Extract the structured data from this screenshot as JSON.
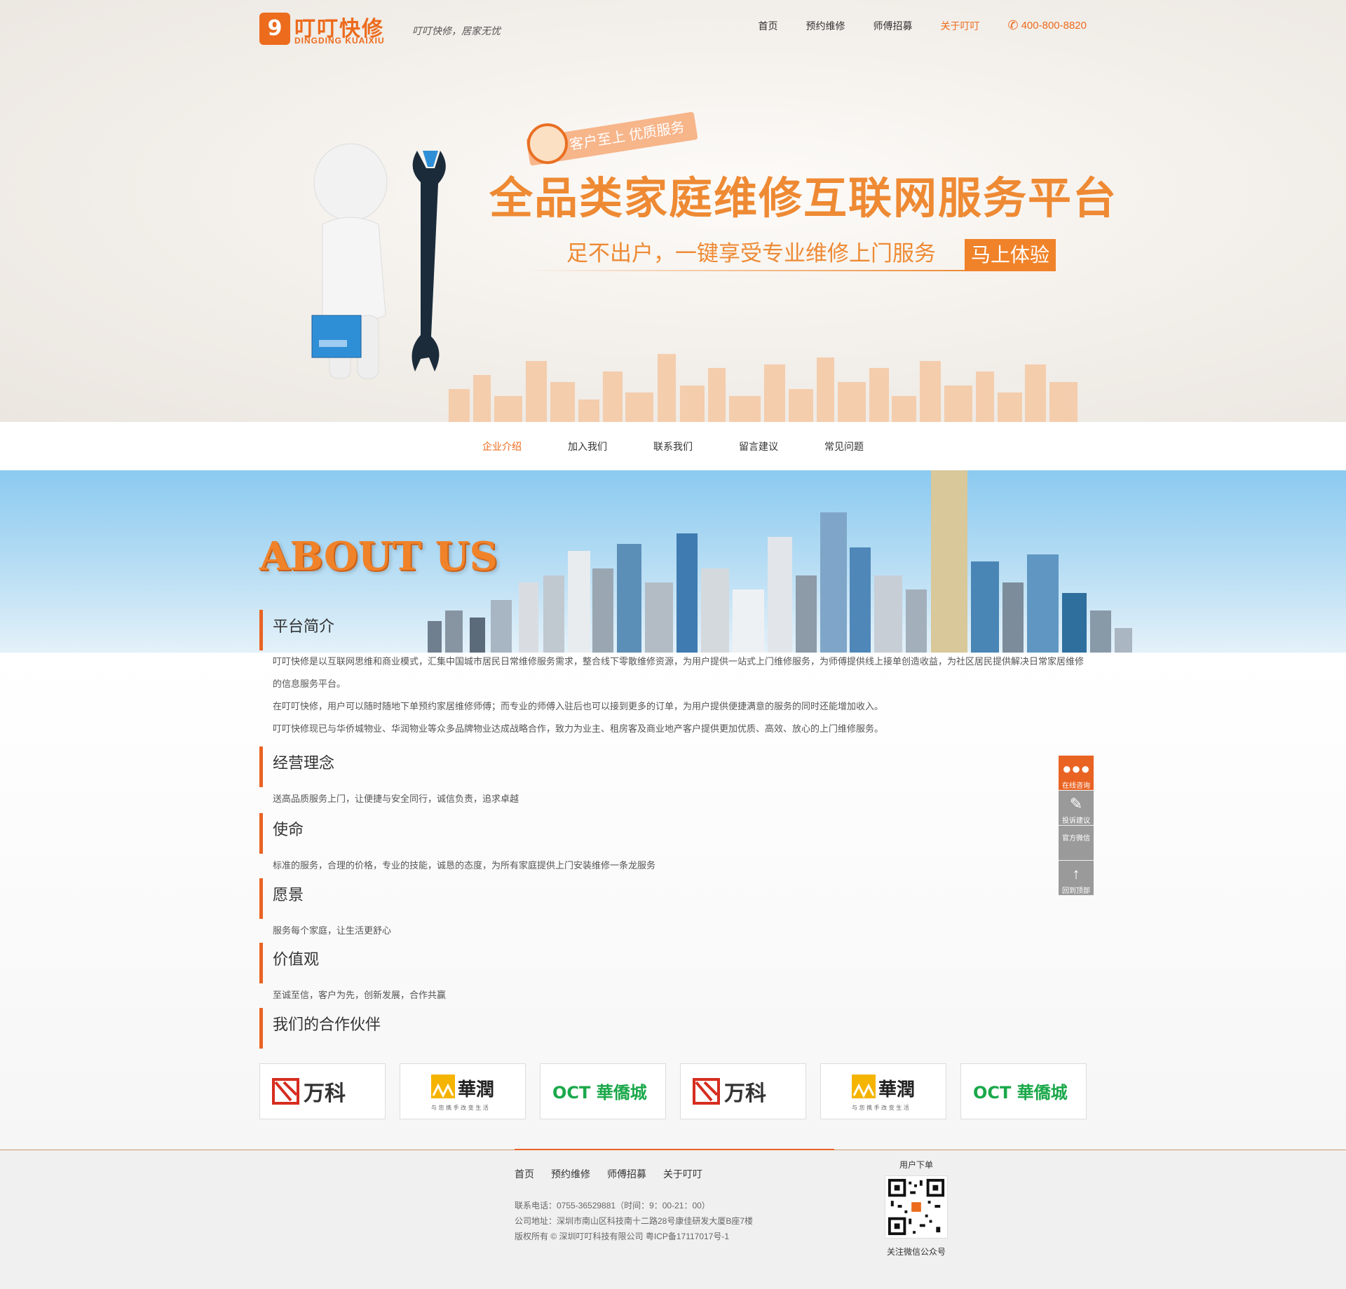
{
  "brand": {
    "mark": "9",
    "name_cn": "叮叮快修",
    "name_en": "DINGDING KUAIXIU",
    "slogan": "叮叮快修，居家无忧"
  },
  "nav": {
    "items": [
      {
        "label": "首页",
        "active": false
      },
      {
        "label": "预约维修",
        "active": false
      },
      {
        "label": "师傅招募",
        "active": false
      },
      {
        "label": "关于叮叮",
        "active": true
      }
    ],
    "phone": "400-800-8820"
  },
  "hero": {
    "badge": "客户至上 优质服务",
    "title": "全品类家庭维修互联网服务平台",
    "subtitle": "足不出户，一键享受专业维修上门服务",
    "cta": "马上体验"
  },
  "subnav": {
    "items": [
      {
        "label": "企业介绍",
        "active": true
      },
      {
        "label": "加入我们",
        "active": false
      },
      {
        "label": "联系我们",
        "active": false
      },
      {
        "label": "留言建议",
        "active": false
      },
      {
        "label": "常见问题",
        "active": false
      }
    ]
  },
  "about": {
    "title": "ABOUT US",
    "sections": [
      {
        "heading": "平台简介",
        "paragraphs": [
          "叮叮快修是以互联网思维和商业模式，汇集中国城市居民日常维修服务需求，整合线下零散维修资源，为用户提供一站式上门维修服务，为师傅提供线上接单创造收益，为社区居民提供解决日常家居维修的信息服务平台。",
          "在叮叮快修，用户可以随时随地下单预约家居维修师傅；而专业的师傅入驻后也可以接到更多的订单，为用户提供便捷满意的服务的同时还能增加收入。",
          "叮叮快修现已与华侨城物业、华润物业等众多品牌物业达成战略合作，致力为业主、租房客及商业地产客户提供更加优质、高效、放心的上门维修服务。"
        ]
      },
      {
        "heading": "经营理念",
        "paragraphs": [
          "送高品质服务上门，让便捷与安全同行，诚信负责，追求卓越"
        ]
      },
      {
        "heading": "使命",
        "paragraphs": [
          "标准的服务，合理的价格，专业的技能，诚恳的态度，为所有家庭提供上门安装维修一条龙服务"
        ]
      },
      {
        "heading": "愿景",
        "paragraphs": [
          "服务每个家庭，让生活更舒心"
        ]
      },
      {
        "heading": "价值观",
        "paragraphs": [
          "至诚至信，客户为先，创新发展，合作共赢"
        ]
      },
      {
        "heading": "我们的合作伙伴",
        "paragraphs": []
      }
    ]
  },
  "partners": [
    {
      "name": "万科",
      "type": "vanke"
    },
    {
      "name": "華潤",
      "tagline": "与 您 携 手 改 变 生 活",
      "type": "crc"
    },
    {
      "name": "OCT 華僑城",
      "type": "oct"
    },
    {
      "name": "万科",
      "type": "vanke"
    },
    {
      "name": "華潤",
      "tagline": "与 您 携 手 改 变 生 活",
      "type": "crc"
    },
    {
      "name": "OCT 華僑城",
      "type": "oct"
    }
  ],
  "side_float": [
    {
      "label": "在线咨询",
      "icon": "chat-icon",
      "color": "#e96323"
    },
    {
      "label": "投诉建议",
      "icon": "edit-icon",
      "color": "#9a9a9a"
    },
    {
      "label": "官方微信",
      "icon": "",
      "color": "#9a9a9a"
    },
    {
      "label": "回到顶部",
      "icon": "arrow-up-icon",
      "color": "#9a9a9a"
    }
  ],
  "footer": {
    "nav": [
      "首页",
      "预约维修",
      "师傅招募",
      "关于叮叮"
    ],
    "phone": "联系电话：0755-36529881（时间：9：00-21：00）",
    "address": "公司地址：深圳市南山区科技南十二路28号康佳研发大厦B座7楼",
    "copyright": "版权所有 ©    深圳叮叮科技有限公司  粤ICP备17117017号-1",
    "qr_title": "用户下单",
    "qr_caption": "关注微信公众号"
  },
  "colors": {
    "brand_orange": "#ec6b1d",
    "hero_orange": "#ee8a34",
    "side_gray": "#9a9a9a"
  }
}
